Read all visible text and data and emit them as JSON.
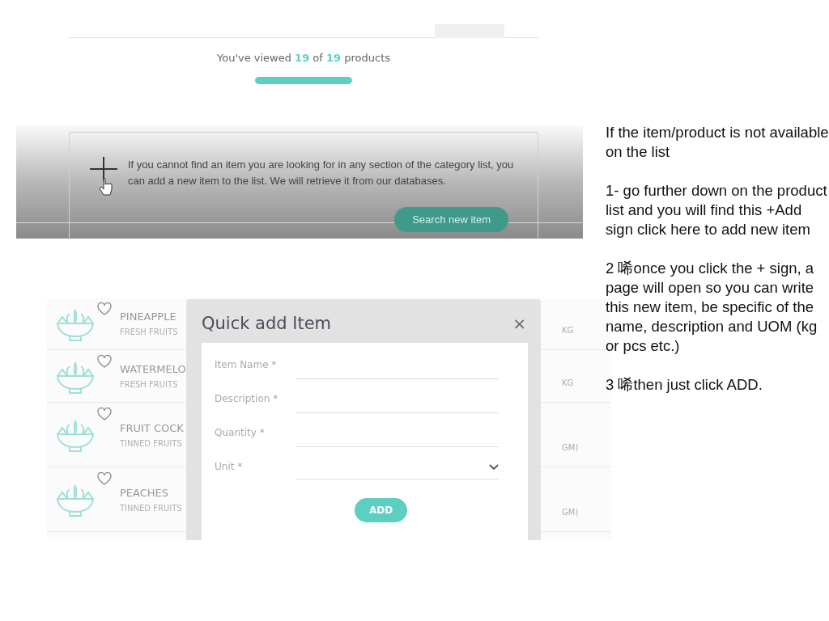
{
  "top_screenshot": {
    "progress_text": "You've viewed **19** of **19** products",
    "progress": {
      "level": 1
    },
    "notice": "If you cannot find an item you are looking for in any section of the category list, you can add a new item to the list. We will retrieve it from our databases.",
    "search_button": "Search new item"
  },
  "bottom_screenshot": {
    "products": [
      {
        "name": "PINEAPPLE",
        "category": "FRESH FRUITS",
        "unit": "KG"
      },
      {
        "name": "WATERMELO",
        "category": "FRESH FRUITS",
        "unit": "KG"
      },
      {
        "name": "FRUIT COCK",
        "category": "TINNED FRUITS",
        "unit": "GM)"
      },
      {
        "name": "PEACHES",
        "category": "TINNED FRUITS",
        "unit": "GM)"
      }
    ],
    "dialog": {
      "title": "Quick add Item",
      "close": "×",
      "fields": [
        {
          "label": "Item Name *",
          "kind": "text"
        },
        {
          "label": "Description *",
          "kind": "text"
        },
        {
          "label": "Quantity *",
          "kind": "text"
        },
        {
          "label": "Unit *",
          "kind": "select"
        }
      ],
      "add_button": "ADD"
    }
  },
  "instructions": [
    "If the item/product is not available on the list",
    "1- go further down on the product list and you will find this +Add sign click here to add new item",
    "2 唏once you click the + sign, a page will open so you can write this new item, be specific of the name, description and UOM (kg or pcs etc.)",
    "3 唏then just click ADD."
  ]
}
